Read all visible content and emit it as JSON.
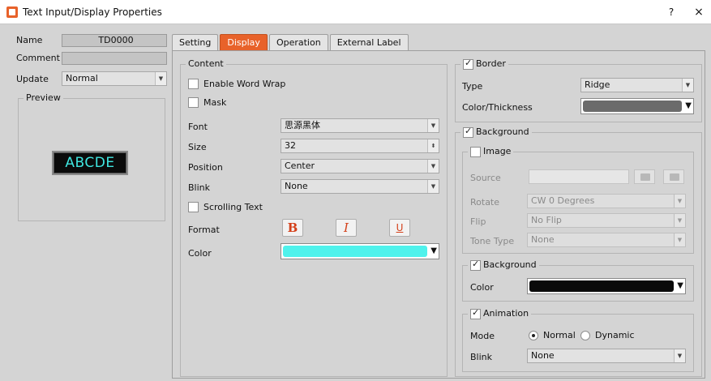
{
  "window": {
    "title": "Text Input/Display Properties",
    "help": "?",
    "close": "×"
  },
  "left": {
    "name_label": "Name",
    "name_value": "TD0000",
    "comment_label": "Comment",
    "comment_value": "",
    "update_label": "Update",
    "update_value": "Normal",
    "preview_label": "Preview",
    "preview_text": "ABCDE"
  },
  "tabs": [
    "Setting",
    "Display",
    "Operation",
    "External Label"
  ],
  "active_tab": "Display",
  "content": {
    "title": "Content",
    "word_wrap": "Enable Word Wrap",
    "mask": "Mask",
    "font_label": "Font",
    "font_value": "思源黑体",
    "size_label": "Size",
    "size_value": "32",
    "position_label": "Position",
    "position_value": "Center",
    "blink_label": "Blink",
    "blink_value": "None",
    "scrolling": "Scrolling Text",
    "format_label": "Format",
    "bold": "B",
    "italic": "I",
    "underline": "U",
    "color_label": "Color",
    "color_value": "#4ff2ec"
  },
  "border": {
    "title": "Border",
    "checked": true,
    "type_label": "Type",
    "type_value": "Ridge",
    "color_label": "Color/Thickness",
    "color_value": "#6b6b6b"
  },
  "background": {
    "title": "Background",
    "checked": true,
    "image": {
      "title": "Image",
      "checked": false,
      "source_label": "Source",
      "source_value": "",
      "rotate_label": "Rotate",
      "rotate_value": "CW 0 Degrees",
      "flip_label": "Flip",
      "flip_value": "No Flip",
      "tone_label": "Tone Type",
      "tone_value": "None"
    },
    "bg": {
      "title": "Background",
      "checked": true,
      "color_label": "Color",
      "color_value": "#0a0a0a"
    },
    "animation": {
      "title": "Animation",
      "checked": true,
      "mode_label": "Mode",
      "mode_normal": "Normal",
      "mode_dynamic": "Dynamic",
      "mode_selected": "Normal",
      "blink_label": "Blink",
      "blink_value": "None"
    }
  }
}
